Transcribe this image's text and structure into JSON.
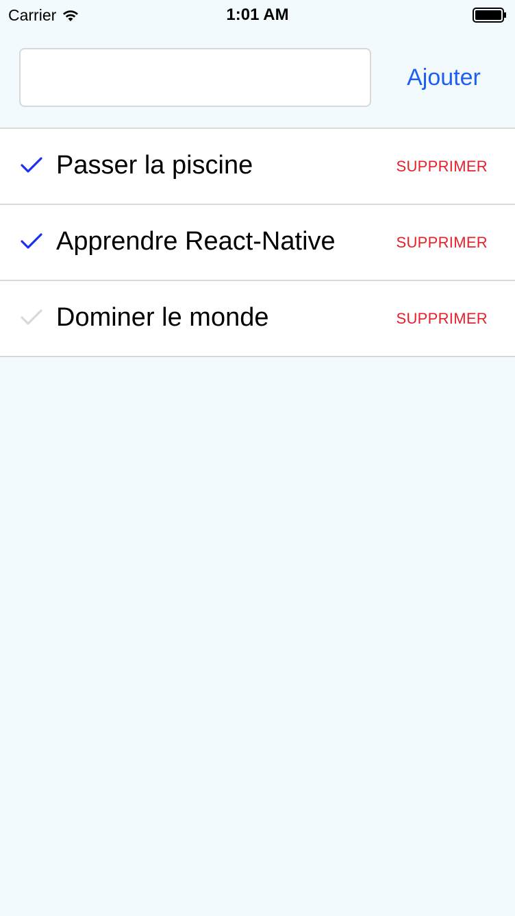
{
  "status_bar": {
    "carrier": "Carrier",
    "time": "1:01 AM"
  },
  "header": {
    "input_value": "",
    "input_placeholder": "",
    "add_label": "Ajouter"
  },
  "colors": {
    "accent": "#1d5ff0",
    "check_done": "#1a2ff0",
    "check_pending": "#d9d9d9",
    "delete": "#e8202a",
    "background": "#f3fafd"
  },
  "todos": [
    {
      "label": "Passer la piscine",
      "done": true,
      "delete_label": "SUPPRIMER",
      "icon": "checkmark-icon"
    },
    {
      "label": "Apprendre React-Native",
      "done": true,
      "delete_label": "SUPPRIMER",
      "icon": "checkmark-icon"
    },
    {
      "label": "Dominer le monde",
      "done": false,
      "delete_label": "SUPPRIMER",
      "icon": "checkmark-icon"
    }
  ]
}
